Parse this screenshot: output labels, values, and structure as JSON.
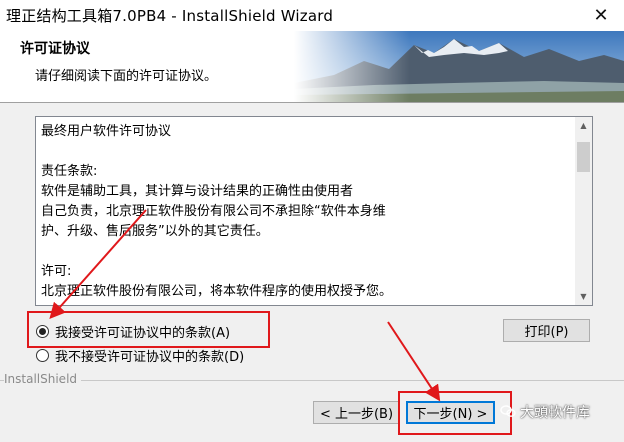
{
  "window": {
    "title": "理正结构工具箱7.0PB4 - InstallShield Wizard",
    "close_glyph": "✕"
  },
  "header": {
    "title": "许可证协议",
    "subtitle": "请仔细阅读下面的许可证协议。"
  },
  "license": {
    "lines": [
      "最终用户软件许可协议",
      "",
      "责任条款:",
      "        软件是辅助工具，其计算与设计结果的正确性由使用者",
      "自己负责，北京理正软件股份有限公司不承担除“软件本身维",
      "护、升级、售后服务”以外的其它责任。",
      "",
      "许可:",
      "        北京理正软件股份有限公司，将本软件程序的使用权授予您。"
    ]
  },
  "options": {
    "accept": "我接受许可证协议中的条款(A)",
    "decline": "我不接受许可证协议中的条款(D)",
    "selected": "accept"
  },
  "buttons": {
    "print": "打印(P)",
    "back": "< 上一步(B)",
    "next": "下一步(N) >"
  },
  "footer": {
    "brand": "InstallShield"
  },
  "watermark": {
    "text": "大頭軟件库"
  },
  "colors": {
    "highlight": "#e0181b",
    "sky": "#4f86c6",
    "mountain": "#5a6a7c"
  }
}
